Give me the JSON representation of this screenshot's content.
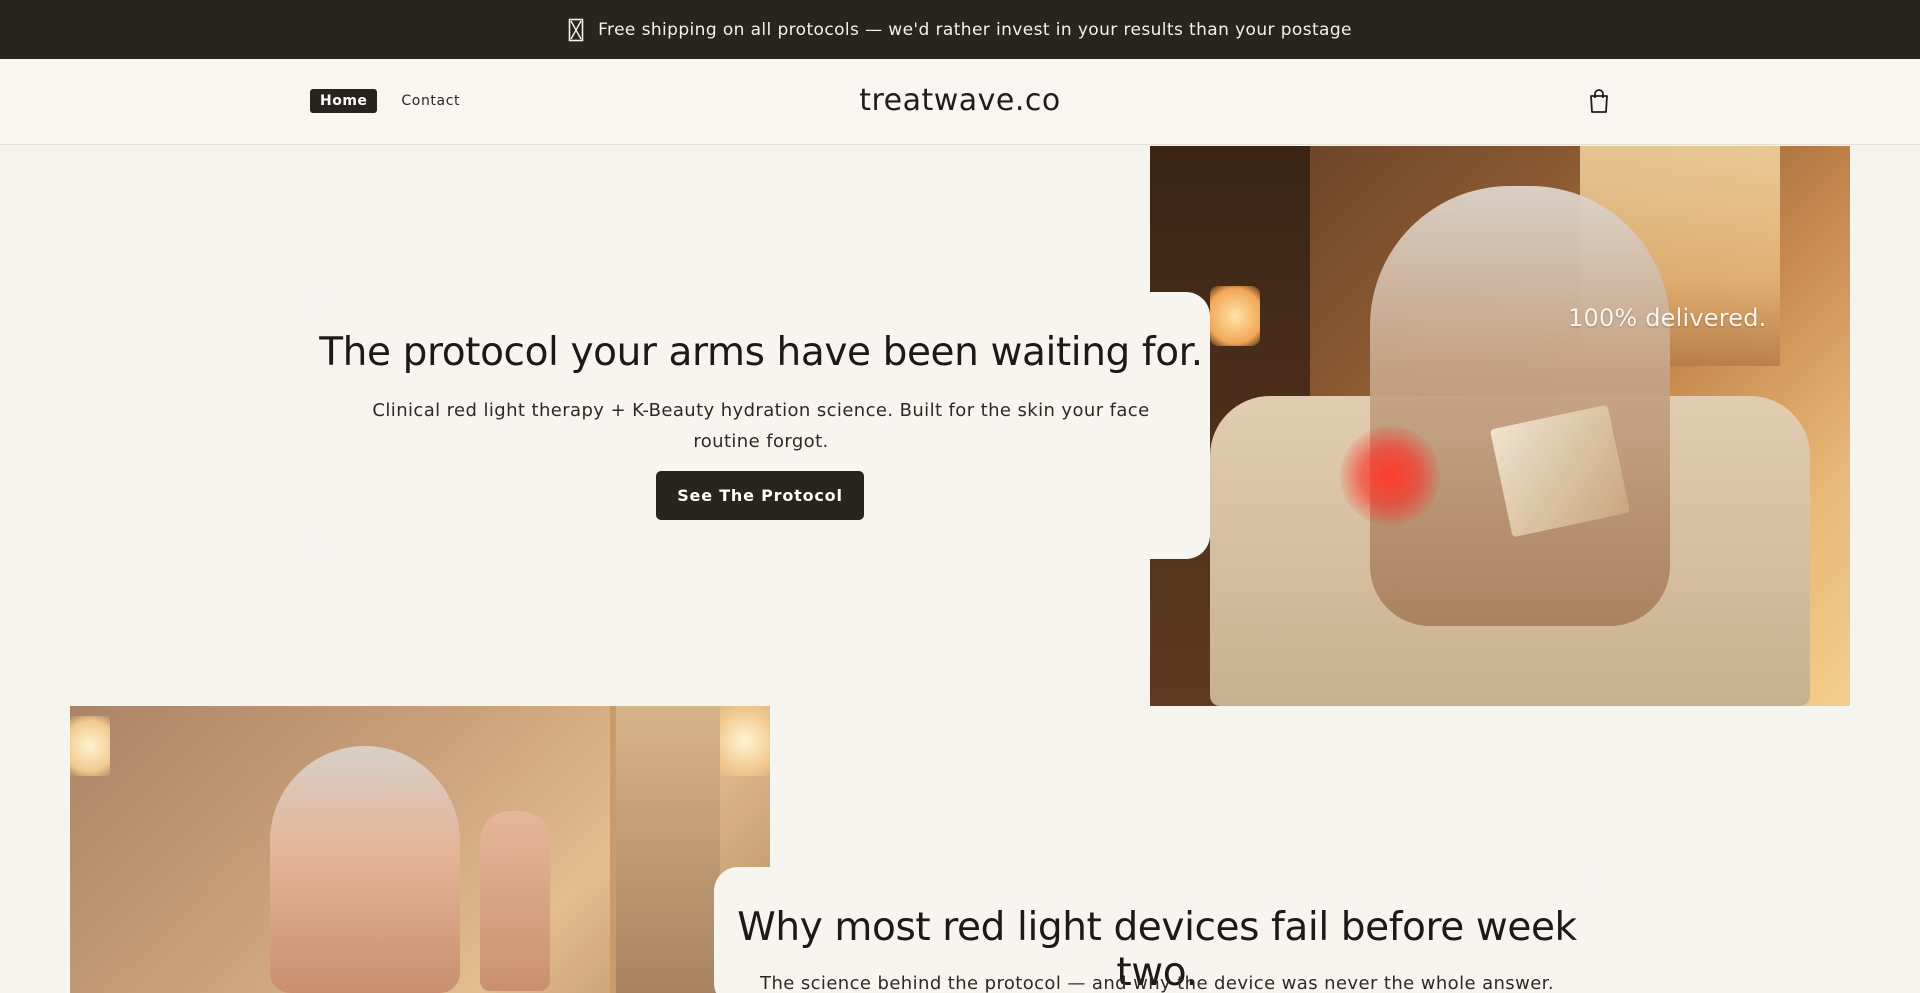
{
  "announcement": {
    "icon": "hourglass-icon",
    "text": "Free shipping on all protocols — we'd rather invest in your results than your postage"
  },
  "header": {
    "nav": [
      {
        "label": "Home",
        "active": true
      },
      {
        "label": "Contact",
        "active": false
      }
    ],
    "logo": "treatwave.co",
    "cart_icon": "shopping-bag-icon"
  },
  "hero": {
    "title": "The protocol your arms have been waiting for.",
    "subtitle": "Clinical red light therapy + K-Beauty hydration science. Built for the skin your face routine forgot.",
    "cta_label": "See The Protocol",
    "image_caption": "100% delivered."
  },
  "section2": {
    "title": "Why most red light devices fail before week two.",
    "subtitle": "The science behind the protocol — and why the device was never the whole answer."
  },
  "colors": {
    "announcement_bg": "#28251f",
    "page_bg": "#f6f4ef",
    "button_bg": "#28251f"
  }
}
